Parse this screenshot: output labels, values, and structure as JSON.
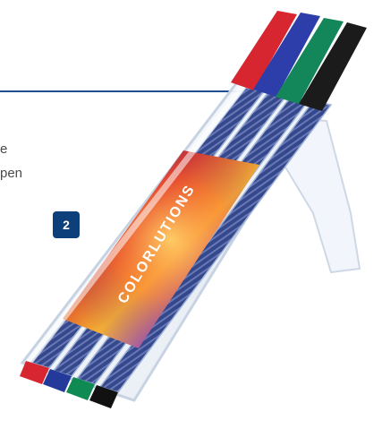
{
  "page": {
    "text_fragment_1": "e",
    "text_fragment_2": "pen",
    "badge_number": "2"
  },
  "product": {
    "brand_label": "COLORLUTIONS",
    "pen_colors": [
      "#d7262f",
      "#243a9b",
      "#0f8a52",
      "#111111"
    ],
    "cap_colors": [
      "#d7262f",
      "#2d3eaa",
      "#13865a",
      "#1b1b1b"
    ]
  },
  "colors": {
    "rule": "#1e4f8f",
    "badge_bg": "#0d3f7a",
    "case_body": "#eef3f8"
  }
}
